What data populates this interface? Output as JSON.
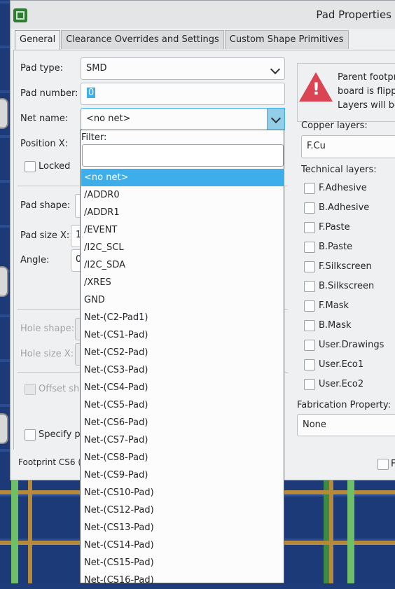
{
  "window": {
    "title": "Pad Properties"
  },
  "tabs": [
    "General",
    "Clearance Overrides and Settings",
    "Custom Shape Primitives"
  ],
  "general": {
    "pad_type_label": "Pad type:",
    "pad_type_value": "SMD",
    "pad_number_label": "Pad number:",
    "pad_number_value": "0",
    "net_name_label": "Net name:",
    "net_name_value": "<no net>",
    "position_x_label": "Position X:",
    "locked_label": "Locked",
    "pad_shape_label": "Pad shape:",
    "pad_size_x_label": "Pad size X:",
    "pad_size_x_value": "1",
    "angle_label": "Angle:",
    "angle_value": "0",
    "hole_shape_label": "Hole shape:",
    "hole_size_x_label": "Hole size X:",
    "offset_label": "Offset sha",
    "specify_label": "Specify pa"
  },
  "warning": {
    "text": "Parent footpri\nboard is flippe\nLayers will be"
  },
  "layers": {
    "copper_label": "Copper layers:",
    "copper_value": "F.Cu",
    "technical_label": "Technical layers:",
    "technical": [
      "F.Adhesive",
      "B.Adhesive",
      "F.Paste",
      "B.Paste",
      "F.Silkscreen",
      "B.Silkscreen",
      "F.Mask",
      "B.Mask",
      "User.Drawings",
      "User.Eco1",
      "User.Eco2"
    ],
    "fab_label": "Fabrication Property:",
    "fab_value": "None"
  },
  "footer": {
    "text": "Footprint CS6 (r",
    "right_text": "F"
  },
  "dropdown": {
    "filter_label": "Filter:",
    "filter_value": "",
    "items": [
      "<no net>",
      "/ADDR0",
      "/ADDR1",
      "/EVENT",
      "/I2C_SCL",
      "/I2C_SDA",
      "/XRES",
      "GND",
      "Net-(C2-Pad1)",
      "Net-(CS1-Pad)",
      "Net-(CS2-Pad)",
      "Net-(CS3-Pad)",
      "Net-(CS4-Pad)",
      "Net-(CS5-Pad)",
      "Net-(CS6-Pad)",
      "Net-(CS7-Pad)",
      "Net-(CS8-Pad)",
      "Net-(CS9-Pad)",
      "Net-(CS10-Pad)",
      "Net-(CS12-Pad)",
      "Net-(CS13-Pad)",
      "Net-(CS14-Pad)",
      "Net-(CS15-Pad)",
      "Net-(CS16-Pad)"
    ],
    "selected_index": 0
  },
  "colors": {
    "accent": "#3daee9",
    "warning": "#da4453"
  }
}
